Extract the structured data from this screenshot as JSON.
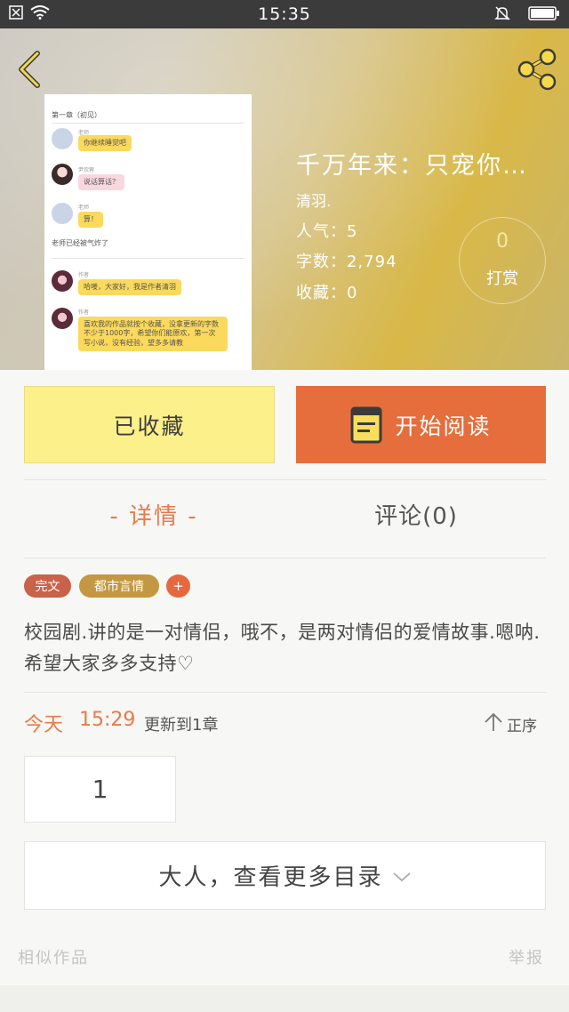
{
  "status_bar": {
    "time": "15:35"
  },
  "book": {
    "title": "千万年来：只宠你…",
    "author": "清羽.",
    "popularity": "人气：5",
    "word_count": "字数：2,794",
    "favorites": "收藏：0",
    "tip_count": "0",
    "tip_label": "打赏"
  },
  "cover_preview": {
    "chapter": "第一章（初见）",
    "messages": [
      {
        "name": "老师",
        "text": "你继续睡觉吧"
      },
      {
        "name": "尹欢蓉",
        "text": "说话算话？"
      },
      {
        "name": "老师",
        "text": "算！"
      }
    ],
    "narration": "老师已经被气炸了",
    "author_messages": [
      {
        "name": "作者",
        "text": "哈喽，大家好，我是作者清羽"
      },
      {
        "name": "作者",
        "text": "喜欢我的作品就按个收藏，没拿更新的字数不少于1000字，希望你们能原欢，第一次写小说，没有经验，望多多请教"
      }
    ]
  },
  "actions": {
    "collected_label": "已收藏",
    "read_label": "开始阅读"
  },
  "tabs": {
    "detail": "- 详情 -",
    "comments": "评论(0)"
  },
  "tags": {
    "status": "完文",
    "genre": "都市言情",
    "add": "+"
  },
  "synopsis": "校园剧.讲的是一对情侣，哦不，是两对情侣的爱情故事.嗯呐.希望大家多多支持♡",
  "update": {
    "day": "今天",
    "time": "15:29",
    "text": "更新到1章",
    "sort_label": "正序"
  },
  "chapters": [
    "1"
  ],
  "catalog": {
    "more_label": "大人，查看更多目录"
  },
  "footer": {
    "similar": "相似作品",
    "report": "举报"
  },
  "colors": {
    "accent_orange": "#e56e3c",
    "collected_yellow": "#fcf08a",
    "tag_done": "#c8624a",
    "tag_genre": "#c49842"
  }
}
